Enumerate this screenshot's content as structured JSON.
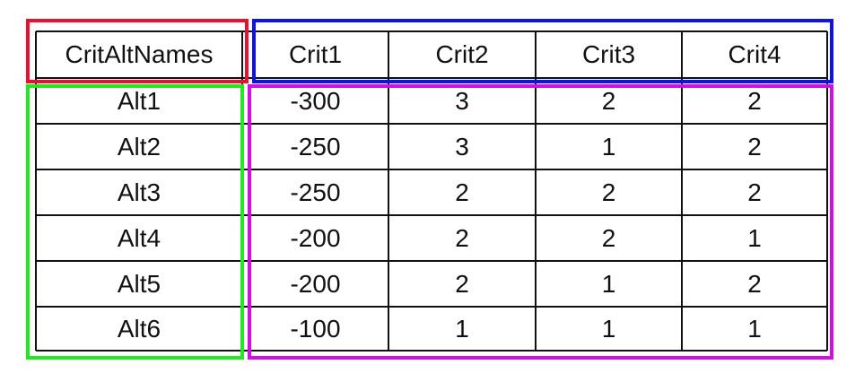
{
  "table": {
    "corner": "CritAltNames",
    "columns": [
      "Crit1",
      "Crit2",
      "Crit3",
      "Crit4"
    ],
    "rows": [
      {
        "name": "Alt1",
        "values": [
          "-300",
          "3",
          "2",
          "2"
        ]
      },
      {
        "name": "Alt2",
        "values": [
          "-250",
          "3",
          "1",
          "2"
        ]
      },
      {
        "name": "Alt3",
        "values": [
          "-250",
          "2",
          "2",
          "2"
        ]
      },
      {
        "name": "Alt4",
        "values": [
          "-200",
          "2",
          "2",
          "1"
        ]
      },
      {
        "name": "Alt5",
        "values": [
          "-200",
          "2",
          "1",
          "2"
        ]
      },
      {
        "name": "Alt6",
        "values": [
          "-100",
          "1",
          "1",
          "1"
        ]
      }
    ]
  },
  "highlights": {
    "header_corner_color": "#e8102e",
    "column_headers_color": "#1010e8",
    "row_names_color": "#22e822",
    "values_color": "#d010e0"
  }
}
